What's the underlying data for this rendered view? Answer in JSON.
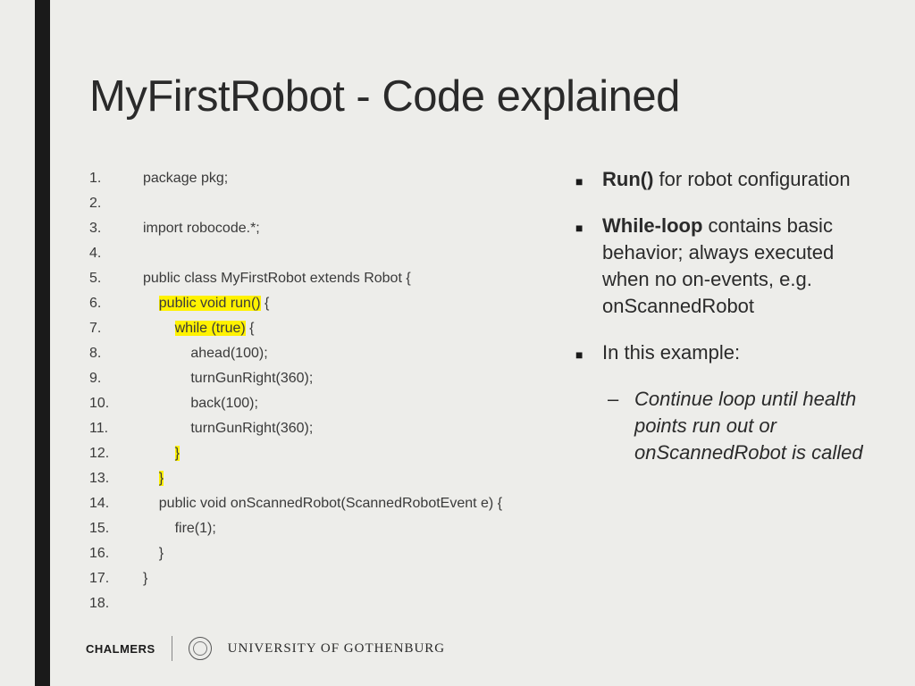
{
  "title": "MyFirstRobot - Code explained",
  "code": [
    {
      "n": "1.",
      "pre": "",
      "hl": "",
      "post": "package pkg;"
    },
    {
      "n": "2.",
      "pre": "",
      "hl": "",
      "post": ""
    },
    {
      "n": "3.",
      "pre": "",
      "hl": "",
      "post": "import robocode.*;"
    },
    {
      "n": "4.",
      "pre": "",
      "hl": "",
      "post": ""
    },
    {
      "n": "5.",
      "pre": "",
      "hl": "",
      "post": "public class MyFirstRobot extends Robot {"
    },
    {
      "n": "6.",
      "pre": "    ",
      "hl": "public void run()",
      "post": " {"
    },
    {
      "n": "7.",
      "pre": "        ",
      "hl": "while (true)",
      "post": " {"
    },
    {
      "n": "8.",
      "pre": "",
      "hl": "",
      "post": "            ahead(100);"
    },
    {
      "n": "9.",
      "pre": "",
      "hl": "",
      "post": "            turnGunRight(360);"
    },
    {
      "n": "10.",
      "pre": "",
      "hl": "",
      "post": "            back(100);"
    },
    {
      "n": "11.",
      "pre": "",
      "hl": "",
      "post": "            turnGunRight(360);"
    },
    {
      "n": "12.",
      "pre": "        ",
      "hl": "}",
      "post": ""
    },
    {
      "n": "13.",
      "pre": "    ",
      "hl": "}",
      "post": ""
    },
    {
      "n": "14.",
      "pre": "",
      "hl": "",
      "post": "    public void onScannedRobot(ScannedRobotEvent e) {"
    },
    {
      "n": "15.",
      "pre": "",
      "hl": "",
      "post": "        fire(1);"
    },
    {
      "n": "16.",
      "pre": "",
      "hl": "",
      "post": "    }"
    },
    {
      "n": "17.",
      "pre": "",
      "hl": "",
      "post": "}"
    },
    {
      "n": "18.",
      "pre": "",
      "hl": "",
      "post": ""
    }
  ],
  "bullets": [
    {
      "bold": "Run()",
      "rest": " for robot configuration",
      "sub": null
    },
    {
      "bold": "While-loop",
      "rest": " contains basic behavior; always executed when no on-events, e.g. onScannedRobot",
      "sub": null
    },
    {
      "bold": "",
      "rest": "In this example:",
      "sub": "Continue loop until health points run out or onScannedRobot is called"
    }
  ],
  "footer": {
    "chalmers": "CHALMERS",
    "gu": "UNIVERSITY OF GOTHENBURG"
  }
}
